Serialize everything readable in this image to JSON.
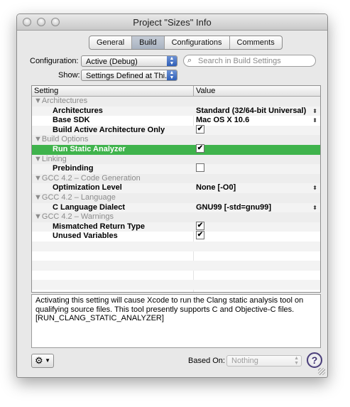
{
  "window": {
    "title": "Project \"Sizes\" Info"
  },
  "tabs": [
    {
      "label": "General",
      "active": false
    },
    {
      "label": "Build",
      "active": true
    },
    {
      "label": "Configurations",
      "active": false
    },
    {
      "label": "Comments",
      "active": false
    }
  ],
  "config": {
    "label": "Configuration:",
    "value": "Active (Debug)",
    "show_label": "Show:",
    "show_value": "Settings Defined at Thi..."
  },
  "search": {
    "placeholder": "Search in Build Settings"
  },
  "table": {
    "col_setting": "Setting",
    "col_value": "Value",
    "rows": [
      {
        "kind": "group",
        "label": "▼Architectures"
      },
      {
        "kind": "item",
        "label": "Architectures",
        "value": "Standard (32/64-bit Universal)",
        "stepper": true
      },
      {
        "kind": "item",
        "label": "Base SDK",
        "value": "Mac OS X 10.6",
        "stepper": true
      },
      {
        "kind": "item",
        "label": "Build Active Architecture Only",
        "check": true
      },
      {
        "kind": "group",
        "label": "▼Build Options"
      },
      {
        "kind": "item",
        "label": "Run Static Analyzer",
        "check": true,
        "selected": true
      },
      {
        "kind": "group",
        "label": "▼Linking"
      },
      {
        "kind": "item",
        "label": "Prebinding",
        "check": false
      },
      {
        "kind": "group",
        "label": "▼GCC 4.2 – Code Generation"
      },
      {
        "kind": "item",
        "label": "Optimization Level",
        "value": "None [-O0]",
        "stepper": true
      },
      {
        "kind": "group",
        "label": "▼GCC 4.2 – Language"
      },
      {
        "kind": "item",
        "label": "C Language Dialect",
        "value": "GNU99 [-std=gnu99]",
        "stepper": true
      },
      {
        "kind": "group",
        "label": "▼GCC 4.2 – Warnings"
      },
      {
        "kind": "item",
        "label": "Mismatched Return Type",
        "check": true
      },
      {
        "kind": "item",
        "label": "Unused Variables",
        "check": true
      }
    ]
  },
  "description": "Activating this setting will cause Xcode to run the Clang static analysis tool on qualifying source files. This tool presently supports C and Objective-C files.\n[RUN_CLANG_STATIC_ANALYZER]",
  "footer": {
    "based_on_label": "Based On:",
    "based_on_value": "Nothing",
    "help": "?"
  },
  "icons": {
    "gear": "gear-icon",
    "help": "help-icon",
    "search": "search-icon"
  }
}
